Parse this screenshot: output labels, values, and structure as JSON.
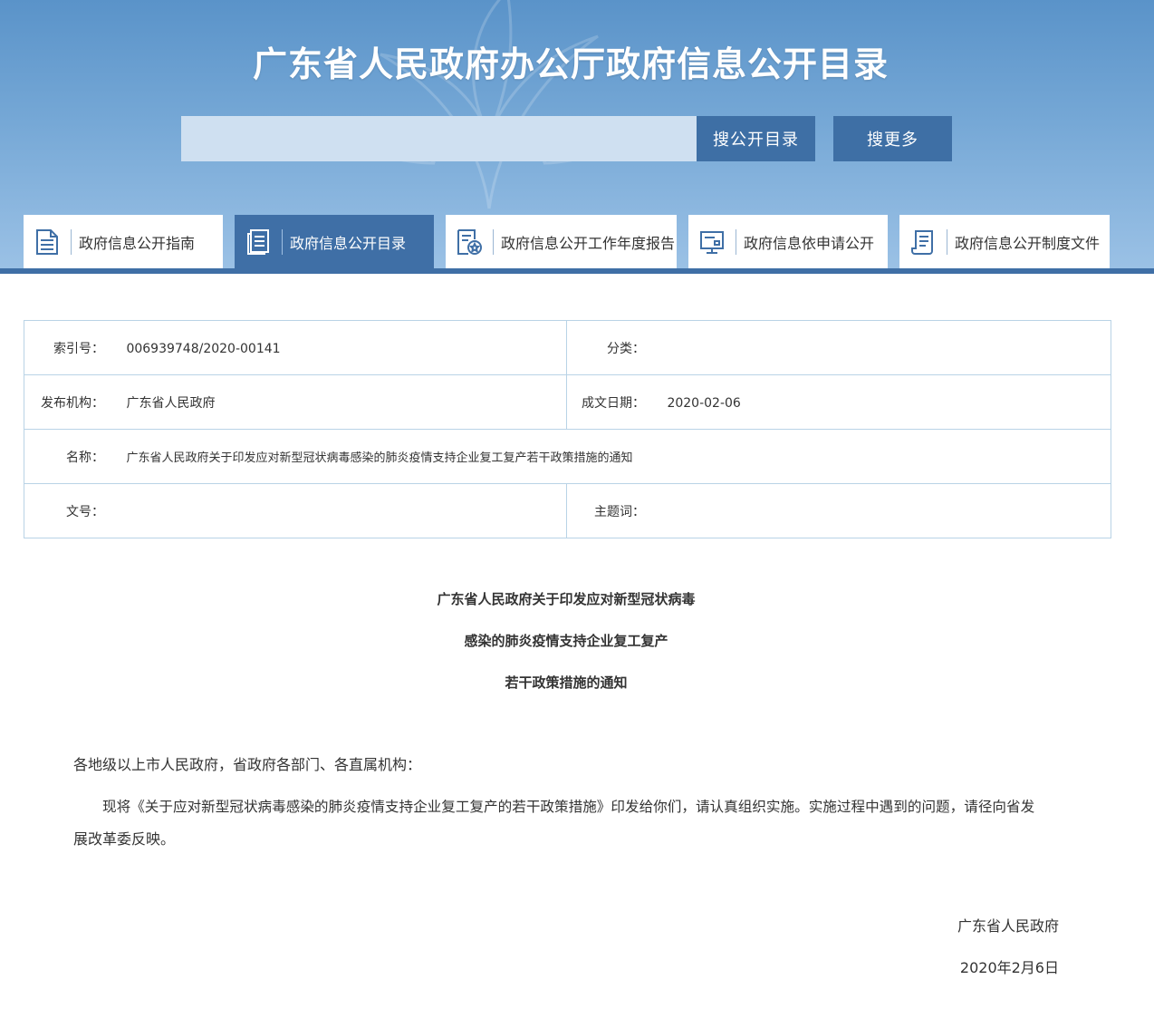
{
  "header": {
    "title": "广东省人民政府办公厅政府信息公开目录",
    "search_placeholder": "",
    "search_button": "搜公开目录",
    "more_button": "搜更多",
    "accent": "#3f6fa6"
  },
  "tabs": [
    {
      "label": "政府信息公开指南",
      "icon": "document-lines-icon",
      "active": false
    },
    {
      "label": "政府信息公开目录",
      "icon": "catalog-list-icon",
      "active": true
    },
    {
      "label": "政府信息公开工作年度报告",
      "icon": "report-star-icon",
      "active": false
    },
    {
      "label": "政府信息依申请公开",
      "icon": "monitor-request-icon",
      "active": false
    },
    {
      "label": "政府信息公开制度文件",
      "icon": "scroll-rules-icon",
      "active": false
    }
  ],
  "info": {
    "index_label": "索引号：",
    "index_value": "006939748/2020-00141",
    "category_label": "分类：",
    "category_value": "",
    "publisher_label": "发布机构：",
    "publisher_value": "广东省人民政府",
    "date_label": "成文日期：",
    "date_value": "2020-02-06",
    "name_label": "名称：",
    "name_value": "广东省人民政府关于印发应对新型冠状病毒感染的肺炎疫情支持企业复工复产若干政策措施的通知",
    "docno_label": "文号：",
    "docno_value": "",
    "keywords_label": "主题词：",
    "keywords_value": ""
  },
  "article": {
    "title_line1": "广东省人民政府关于印发应对新型冠状病毒",
    "title_line2": "感染的肺炎疫情支持企业复工复产",
    "title_line3": "若干政策措施的通知",
    "salutation": "各地级以上市人民政府，省政府各部门、各直属机构：",
    "body_line1": "现将《关于应对新型冠状病毒感染的肺炎疫情支持企业复工复产的若干政策措施》印发给你们，请认真组织实施。实施过程中遇到的问题，请径向省发",
    "body_line2": "展改革委反映。",
    "signature": "广东省人民政府",
    "sign_date": "2020年2月6日"
  }
}
